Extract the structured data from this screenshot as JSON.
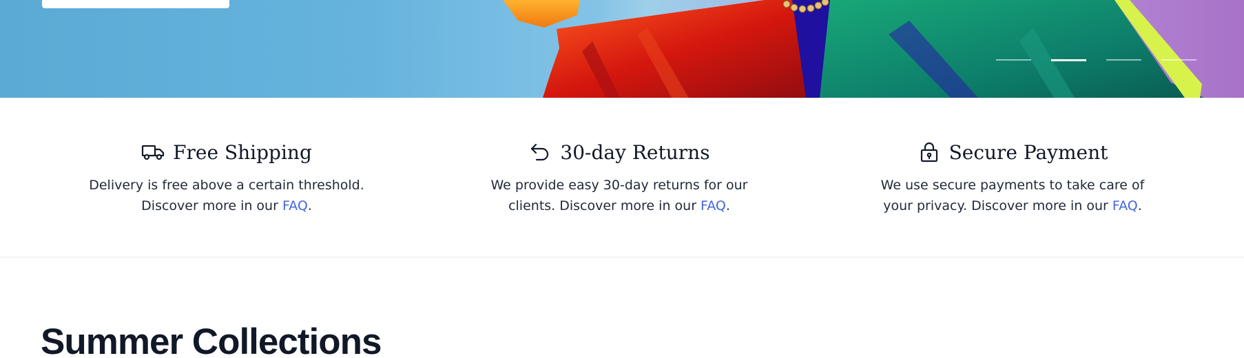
{
  "hero": {
    "slides": [
      {
        "label": "",
        "active": false
      },
      {
        "label": "",
        "active": true
      },
      {
        "label": "",
        "active": false
      },
      {
        "label": "",
        "active": false
      }
    ],
    "colors": {
      "sky": "#66b4de",
      "violet": "#b07fd0"
    }
  },
  "features": [
    {
      "icon": "truck-icon",
      "title": "Free Shipping",
      "text_before": "Delivery is free above a certain threshold. Discover more in our ",
      "link": "FAQ",
      "text_after": "."
    },
    {
      "icon": "return-arrow-icon",
      "title": "30-day Returns",
      "text_before": "We provide easy 30-day returns for our clients. Discover more in our ",
      "link": "FAQ",
      "text_after": "."
    },
    {
      "icon": "lock-icon",
      "title": "Secure Payment",
      "text_before": "We use secure payments to take care of your privacy. Discover more in our ",
      "link": "FAQ",
      "text_after": "."
    }
  ],
  "collections": {
    "title": "Summer Collections"
  },
  "colors": {
    "link": "#4466d8",
    "text": "#111827",
    "divider": "#e5e7eb"
  }
}
